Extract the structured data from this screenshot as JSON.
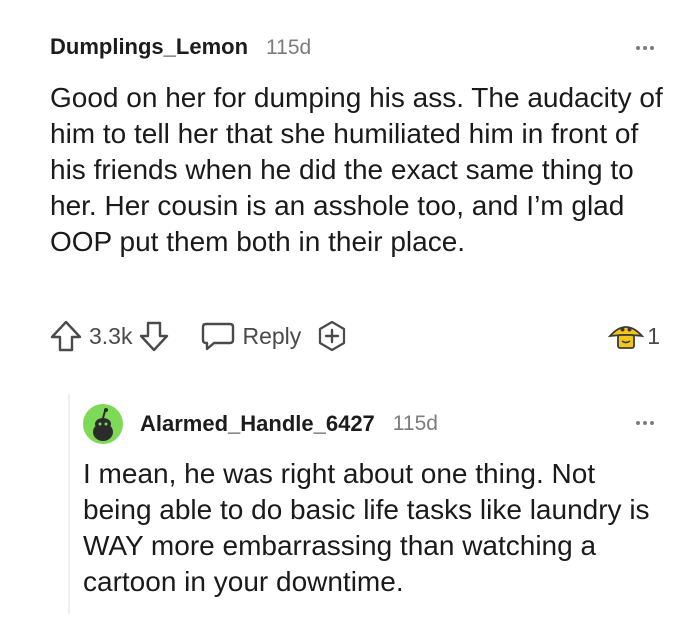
{
  "comment1": {
    "username": "Dumplings_Lemon",
    "age": "115d",
    "text": "Good on her for dumping his ass. The audacity of him to tell her that she humiliated him in front of his friends when he did the exact same thing to her. Her cousin is an asshole too, and I’m glad OOP put them both in their place.",
    "votes": "3.3k",
    "reply_label": "Reply",
    "award_count": "1"
  },
  "comment2": {
    "username": "Alarmed_Handle_6427",
    "age": "115d",
    "text": "I mean, he was right about one thing. Not being able to do basic life tasks like laundry is WAY more embarrassing than watching a cartoon in your downtime."
  },
  "colors": {
    "text": "#1a1a1b",
    "meta": "#7c7c7c",
    "icon": "#4a4a4a",
    "avatar": "#7ed957",
    "award": "#f5c518"
  }
}
